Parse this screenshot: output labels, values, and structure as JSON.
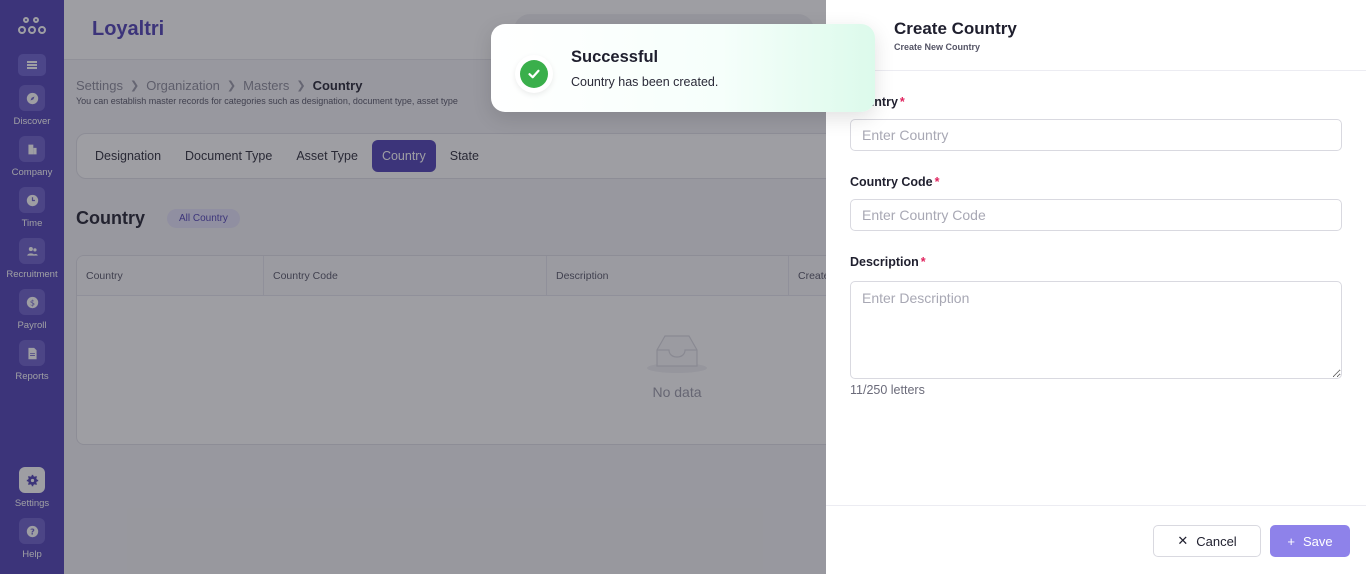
{
  "app": {
    "brand": "Loyaltri"
  },
  "sidebar": {
    "items": [
      {
        "label": "Discover",
        "icon": "compass-icon"
      },
      {
        "label": "Company",
        "icon": "building-icon"
      },
      {
        "label": "Time",
        "icon": "clock-icon"
      },
      {
        "label": "Recruitment",
        "icon": "users-icon"
      },
      {
        "label": "Payroll",
        "icon": "dollar-icon"
      },
      {
        "label": "Reports",
        "icon": "report-icon"
      }
    ],
    "bottom": [
      {
        "label": "Settings",
        "icon": "gear-icon"
      },
      {
        "label": "Help",
        "icon": "help-icon"
      }
    ]
  },
  "breadcrumb": [
    "Settings",
    "Organization",
    "Masters",
    "Country"
  ],
  "page": {
    "subtitle": "You can establish master records for categories such as designation, document type, asset type",
    "tabs": [
      "Designation",
      "Document Type",
      "Asset Type",
      "Country",
      "State"
    ],
    "active_tab": "Country",
    "section_title": "Country",
    "badge": "All Country"
  },
  "table": {
    "columns": [
      "Country",
      "Country Code",
      "Description",
      "Create"
    ],
    "empty_text": "No data"
  },
  "drawer": {
    "title": "Create Country",
    "subtitle": "Create New Country",
    "fields": {
      "country": {
        "label": "Country",
        "placeholder": "Enter Country"
      },
      "code": {
        "label": "Country Code",
        "placeholder": "Enter Country Code"
      },
      "description": {
        "label": "Description",
        "placeholder": "Enter Description"
      }
    },
    "counter": "11/250 letters",
    "cancel_label": "Cancel",
    "save_label": "Save"
  },
  "toast": {
    "title": "Successful",
    "message": "Country has been created."
  },
  "colors": {
    "brand": "#4d3fb5",
    "save_button": "#8e82ea",
    "success": "#3aaf4b",
    "required": "#e0245e"
  }
}
